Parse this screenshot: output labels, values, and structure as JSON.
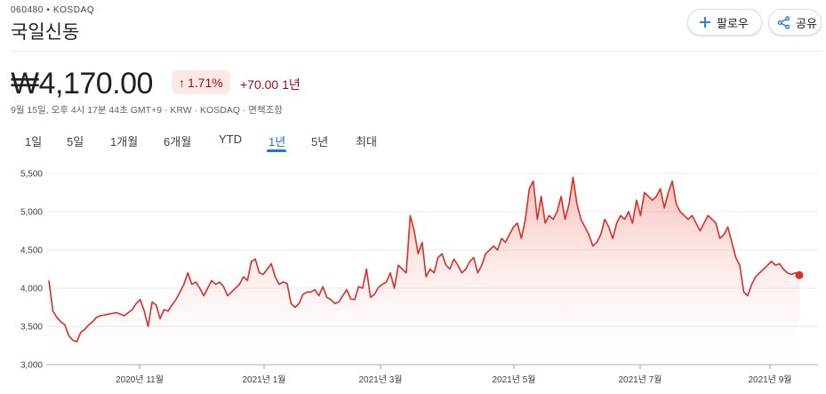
{
  "header": {
    "ticker": "060480 • KOSDAQ",
    "name": "국일신동",
    "follow_label": "팔로우",
    "share_label": "공유"
  },
  "quote": {
    "price": "₩4,170.00",
    "change_pct": "1.71%",
    "change_abs": "+70.00 1년",
    "meta": "9월 15일, 오후 4시 17분 44초 GMT+9 · KRW · KOSDAQ · 면책조항"
  },
  "tabs": [
    {
      "label": "1일"
    },
    {
      "label": "5일"
    },
    {
      "label": "1개월"
    },
    {
      "label": "6개월"
    },
    {
      "label": "YTD"
    },
    {
      "label": "1년",
      "active": true
    },
    {
      "label": "5년"
    },
    {
      "label": "최대"
    }
  ],
  "colors": {
    "accent": "#1a73e8",
    "line": "#d93025",
    "negative_text": "#a50e0e",
    "badge_bg": "#fce8e6"
  },
  "icons": {
    "follow": "plus-icon",
    "share": "share-icon",
    "change": "arrow-up-icon"
  },
  "chart_data": {
    "type": "area",
    "y_ticks": [
      "5,500",
      "5,000",
      "4,500",
      "4,000",
      "3,500",
      "3,000"
    ],
    "x_tick_labels": [
      "2020년 11월",
      "2021년 1월",
      "2021년 3월",
      "2021년 5월",
      "2021년 7월",
      "2021년 9월"
    ],
    "ylim": [
      3000,
      5500
    ],
    "grid": true,
    "series": [
      {
        "values": [
          4100,
          3700,
          3620,
          3560,
          3520,
          3380,
          3320,
          3300,
          3420,
          3460,
          3520,
          3560,
          3620,
          3640,
          3650,
          3660,
          3670,
          3680,
          3660,
          3640,
          3680,
          3720,
          3800,
          3850,
          3700,
          3500,
          3820,
          3780,
          3600,
          3720,
          3700,
          3780,
          3850,
          3950,
          4050,
          4200,
          4050,
          4080,
          4000,
          3900,
          4000,
          4100,
          4050,
          4080,
          4020,
          3900,
          3950,
          4000,
          4050,
          4150,
          4100,
          4350,
          4380,
          4200,
          4180,
          4250,
          4320,
          4150,
          4050,
          4080,
          4060,
          3800,
          3750,
          3800,
          3920,
          3950,
          3950,
          3980,
          3900,
          4020,
          3880,
          3850,
          3800,
          3820,
          3900,
          3980,
          3860,
          3850,
          4020,
          4000,
          4250,
          3880,
          3920,
          4010,
          4050,
          4080,
          4200,
          4000,
          4300,
          4250,
          4200,
          4950,
          4750,
          4450,
          4600,
          4150,
          4250,
          4200,
          4400,
          4450,
          4300,
          4250,
          4380,
          4300,
          4200,
          4250,
          4350,
          4400,
          4200,
          4300,
          4450,
          4500,
          4550,
          4500,
          4650,
          4600,
          4700,
          4800,
          4850,
          4650,
          4900,
          5300,
          5400,
          4900,
          5200,
          4850,
          4950,
          4900,
          5000,
          5200,
          4900,
          5100,
          5450,
          5100,
          4900,
          4800,
          4700,
          4550,
          4600,
          4700,
          4900,
          4800,
          4650,
          4850,
          4950,
          4900,
          5000,
          4850,
          5150,
          4950,
          5250,
          5200,
          5150,
          5200,
          5300,
          5050,
          5250,
          5400,
          5100,
          5000,
          4950,
          4900,
          4950,
          4850,
          4750,
          4850,
          4950,
          4900,
          4850,
          4650,
          4700,
          4800,
          4600,
          4400,
          4300,
          3950,
          3900,
          4050,
          4150,
          4200,
          4250,
          4300,
          4350,
          4300,
          4320,
          4250,
          4200,
          4180,
          4200,
          4170
        ]
      }
    ]
  }
}
